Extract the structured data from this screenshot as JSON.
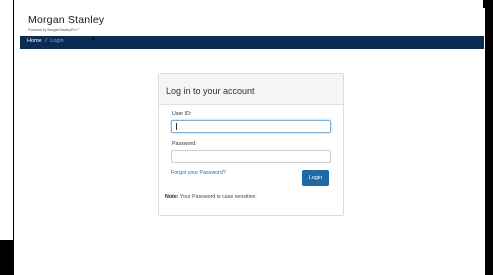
{
  "header": {
    "brand_name": "Morgan Stanley",
    "brand_sub": "Powered by MorganStanleyPro℠"
  },
  "breadcrumb": {
    "home": "Home",
    "separator": "/",
    "current": "Login"
  },
  "login": {
    "title": "Log in to your account",
    "user_label": "User ID:",
    "user_value": "",
    "password_label": "Password:",
    "password_value": "",
    "forgot_link": "Forgot your Password?",
    "submit_label": "Login",
    "note_label": "Note:",
    "note_text": " Your Password is case sensitive."
  },
  "colors": {
    "navbar": "#0b2d53",
    "link": "#2a6fb6",
    "button": "#1f6aa5"
  }
}
